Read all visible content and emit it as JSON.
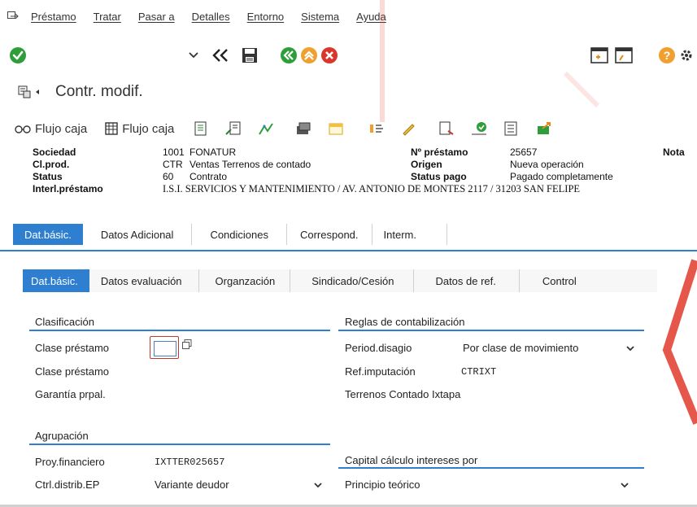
{
  "menu": {
    "items": [
      "Préstamo",
      "Tratar",
      "Pasar a",
      "Detalles",
      "Entorno",
      "Sistema",
      "Ayuda"
    ]
  },
  "toolbar": {
    "icons": [
      "enter-icon",
      "chevron-down-icon",
      "back-double-icon",
      "save-icon",
      "back-green-icon",
      "exit-orange-icon",
      "cancel-red-icon",
      "window-new-icon",
      "window-copy-icon",
      "help-icon",
      "settings-icon"
    ]
  },
  "title": {
    "text": "Contr. modif."
  },
  "app_toolbar": {
    "flujo1": "Flujo caja",
    "flujo2": "Flujo caja"
  },
  "header": {
    "sociedad_label": "Sociedad",
    "sociedad_code": "1001",
    "sociedad_value": "FONATUR",
    "clprod_label": "Cl.prod.",
    "clprod_code": "CTR",
    "clprod_value": "Ventas Terrenos de contado",
    "status_label": "Status",
    "status_code": "60",
    "status_value": "Contrato",
    "interl_label": "Interl.préstamo",
    "interl_value": "I.S.I. SERVICIOS Y MANTENIMIENTO / AV. ANTONIO DE MONTES 2117 / 31203 SAN FELIPE",
    "nprestamo_label": "Nº préstamo",
    "nprestamo_value": "25657",
    "origen_label": "Origen",
    "origen_value": "Nueva operación",
    "statuspago_label": "Status pago",
    "statuspago_value": "Pagado completamente",
    "nota_label": "Nota"
  },
  "tabs_main": [
    "Dat.básic.",
    "Datos Adicional",
    "Condiciones",
    "Correspond.",
    "Interm."
  ],
  "tabs_sub": [
    "Dat.básic.",
    "Datos evaluación",
    "Organzación",
    "Sindicado/Cesión",
    "Datos de ref.",
    "Control"
  ],
  "clasificacion": {
    "title": "Clasificación",
    "clase1_label": "Clase préstamo",
    "clase2_label": "Clase préstamo",
    "garantia_label": "Garantía prpal."
  },
  "reglas": {
    "title": "Reglas de contabilización",
    "period_label": "Period.disagio",
    "period_value": "Por clase de movimiento",
    "refimp_label": "Ref.imputación",
    "refimp_value": "CTRIXT",
    "terrenos_text": "Terrenos Contado Ixtapa"
  },
  "agrupacion": {
    "title": "Agrupación",
    "proy_label": "Proy.financiero",
    "proy_value": "IXTTER025657",
    "ctrl_label": "Ctrl.distrib.EP",
    "ctrl_value": "Variante deudor"
  },
  "capital": {
    "title": "Capital cálculo intereses por",
    "value": "Principio teórico"
  },
  "colors": {
    "accent": "#2f7fd1",
    "ok_green": "#2e9e3a",
    "exit_orange": "#f0a030",
    "cancel_red": "#d9372b"
  }
}
